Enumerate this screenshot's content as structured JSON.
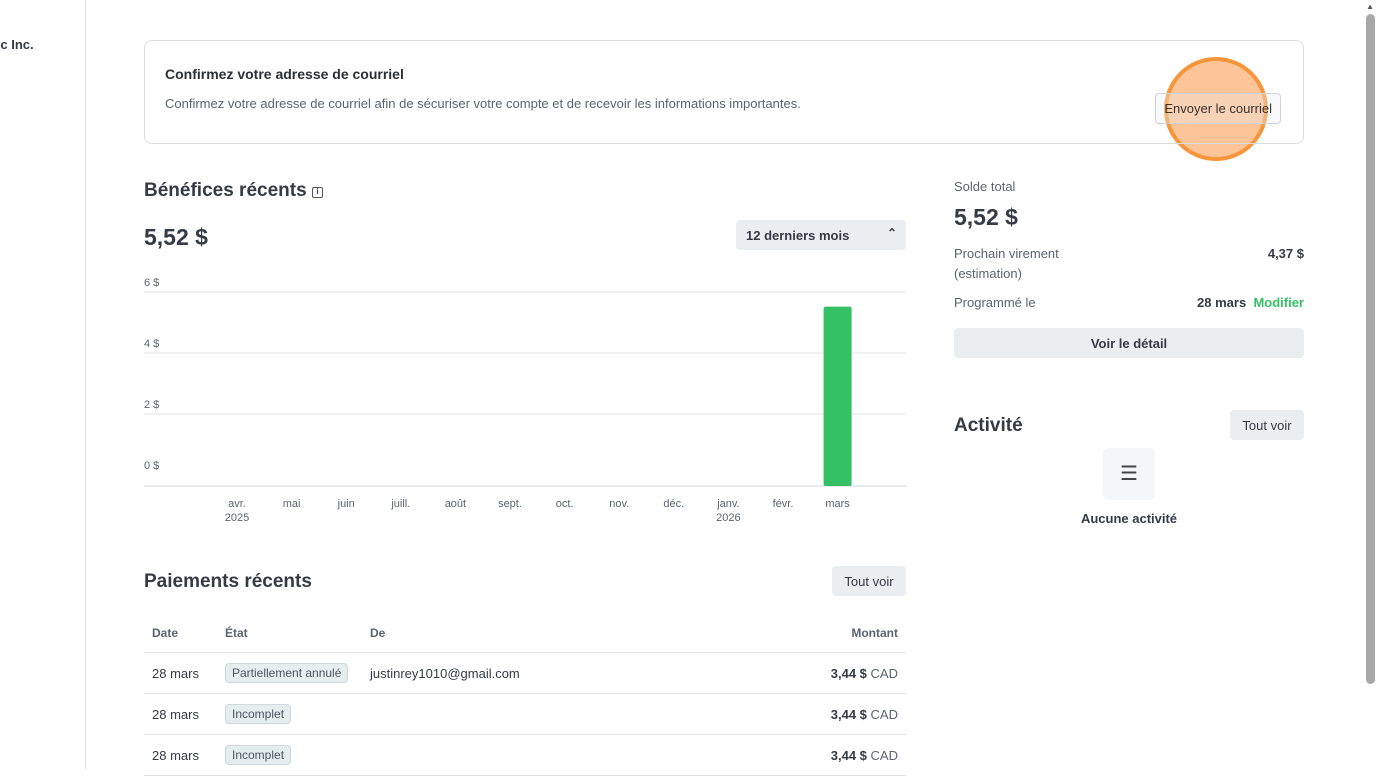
{
  "sidebar": {
    "org_name": "ébec Inc."
  },
  "banner": {
    "title": "Confirmez votre adresse de courriel",
    "text": "Confirmez votre adresse de courriel afin de sécuriser votre compte et de recevoir les informations importantes.",
    "button": "Envoyer le courriel"
  },
  "earnings": {
    "title": "Bénéfices récents",
    "info_icon": "info-icon",
    "total": "5,52 $",
    "period": "12 derniers mois"
  },
  "chart_data": {
    "type": "bar",
    "categories": [
      "avr. 2025",
      "mai",
      "juin",
      "juill.",
      "août",
      "sept.",
      "oct.",
      "nov.",
      "déc.",
      "janv. 2026",
      "févr.",
      "mars"
    ],
    "values": [
      0,
      0,
      0,
      0,
      0,
      0,
      0,
      0,
      0,
      0,
      0,
      5.52
    ],
    "yticks": [
      "0 $",
      "2 $",
      "4 $",
      "6 $"
    ],
    "ylim": [
      0,
      6
    ],
    "grid": true,
    "color": "#34c165"
  },
  "balance": {
    "label": "Solde total",
    "amount": "5,52 $",
    "next_label": "Prochain virement",
    "next_sub": "(estimation)",
    "next_amount": "4,37 $",
    "scheduled_label": "Programmé le",
    "scheduled_date": "28 mars",
    "modify": "Modifier",
    "details_button": "Voir le détail"
  },
  "activity": {
    "title": "Activité",
    "view_all": "Tout voir",
    "empty": "Aucune activité"
  },
  "payments": {
    "title": "Paiements récents",
    "view_all": "Tout voir",
    "columns": [
      "Date",
      "État",
      "De",
      "Montant"
    ],
    "rows": [
      {
        "date": "28 mars",
        "status": "Partiellement annulé",
        "from": "justinrey1010@gmail.com",
        "amount": "3,44 $",
        "currency": "CAD"
      },
      {
        "date": "28 mars",
        "status": "Incomplet",
        "from": "",
        "amount": "3,44 $",
        "currency": "CAD"
      },
      {
        "date": "28 mars",
        "status": "Incomplet",
        "from": "",
        "amount": "3,44 $",
        "currency": "CAD"
      }
    ]
  }
}
